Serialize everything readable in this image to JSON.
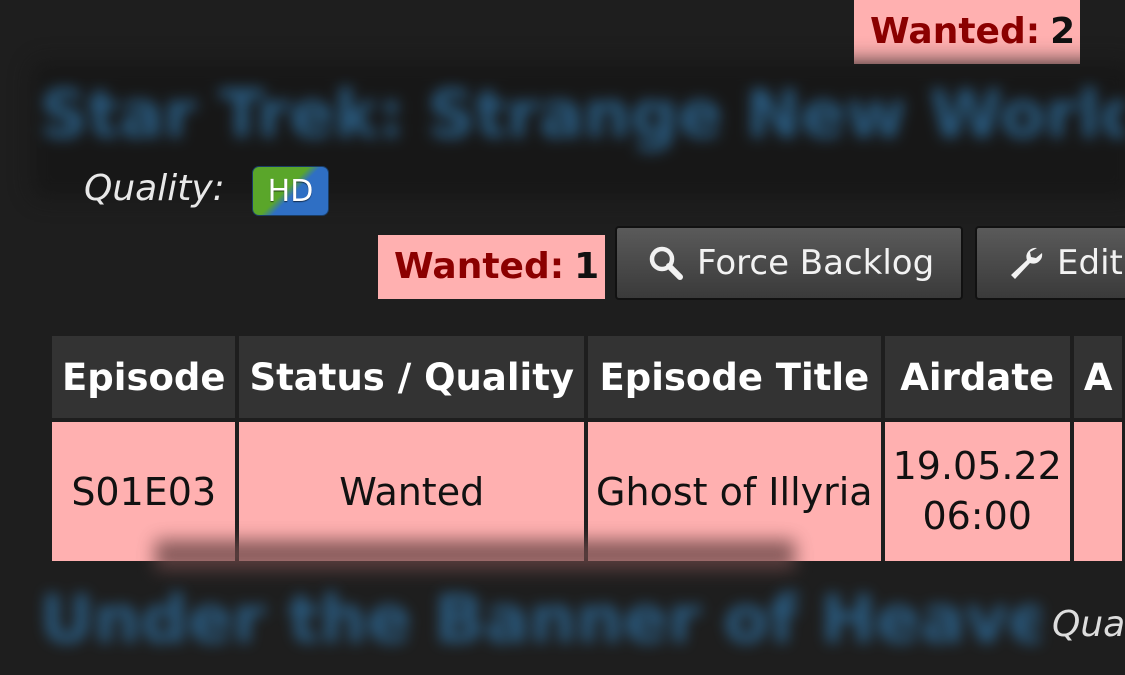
{
  "wanted_top": {
    "label": "Wanted:",
    "count": "2"
  },
  "show_1": {
    "title": "Star Trek: Strange New Worlds",
    "quality_label": "Quality:",
    "quality_badge": "HD",
    "wanted": {
      "label": "Wanted:",
      "count": "1"
    },
    "buttons": {
      "force_backlog": "Force Backlog",
      "edit": "Edit"
    }
  },
  "episodes_table": {
    "headers": [
      "Episode",
      "Status / Quality",
      "Episode Title",
      "Airdate",
      "A"
    ],
    "rows": [
      {
        "episode": "S01E03",
        "status": "Wanted",
        "title": "Ghost of Illyria",
        "airdate_date": "19.05.22",
        "airdate_time": "06:00",
        "extra": ""
      }
    ]
  },
  "show_2": {
    "title": "Under the Banner of Heaven",
    "quality_label": "Qua"
  },
  "colors": {
    "background": "#1e1e1e",
    "wanted_bg": "#ffb0b0",
    "wanted_text": "#8b0000",
    "header_bg": "#333333"
  },
  "icons": {
    "force_backlog": "search-icon",
    "edit": "wrench-icon"
  }
}
